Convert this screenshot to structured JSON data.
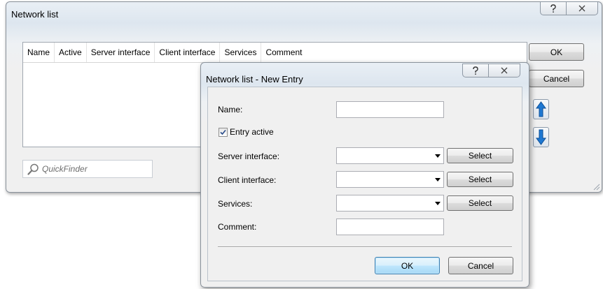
{
  "main_window": {
    "title": "Network list",
    "columns": [
      "Name",
      "Active",
      "Server interface",
      "Client interface",
      "Services",
      "Comment"
    ],
    "ok_label": "OK",
    "cancel_label": "Cancel",
    "quickfinder_placeholder": "QuickFinder",
    "icons": {
      "help": "help-icon",
      "close": "close-icon",
      "up": "arrow-up-icon",
      "down": "arrow-down-icon",
      "search": "search-icon"
    }
  },
  "dialog": {
    "title": "Network list - New Entry",
    "name_label": "Name:",
    "name_value": "",
    "entry_active_label": "Entry active",
    "entry_active_checked": true,
    "server_interface_label": "Server interface:",
    "server_interface_value": "",
    "client_interface_label": "Client interface:",
    "client_interface_value": "",
    "services_label": "Services:",
    "services_value": "",
    "comment_label": "Comment:",
    "comment_value": "",
    "select_label": "Select",
    "ok_label": "OK",
    "cancel_label": "Cancel"
  },
  "colors": {
    "accent_arrow": "#1e78d2",
    "default_button_border": "#3c7fb1"
  }
}
